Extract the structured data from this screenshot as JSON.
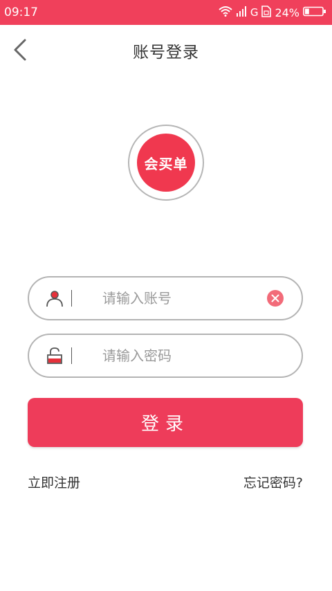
{
  "status_bar": {
    "time": "09:17",
    "network": "G",
    "battery": "24%",
    "battery_level": 0.24,
    "icons": [
      "wifi-icon",
      "signal-icon",
      "sim-icon",
      "battery-icon"
    ]
  },
  "header": {
    "title": "账号登录",
    "back_icon": "back-arrow-icon"
  },
  "logo": {
    "text": "会买单"
  },
  "form": {
    "account_placeholder": "请输入账号",
    "account_value": "",
    "password_placeholder": "请输入密码",
    "password_value": "",
    "account_icon": "user-icon",
    "password_icon": "lock-icon",
    "clear_icon": "clear-icon"
  },
  "actions": {
    "login_label": "登录",
    "register_label": "立即注册",
    "forgot_label": "忘记密码?"
  },
  "colors": {
    "brand": "#f0405b",
    "button": "#ee3c5a",
    "field_border": "#b3b3b3",
    "placeholder": "#9a9a9a",
    "text": "#333333"
  }
}
